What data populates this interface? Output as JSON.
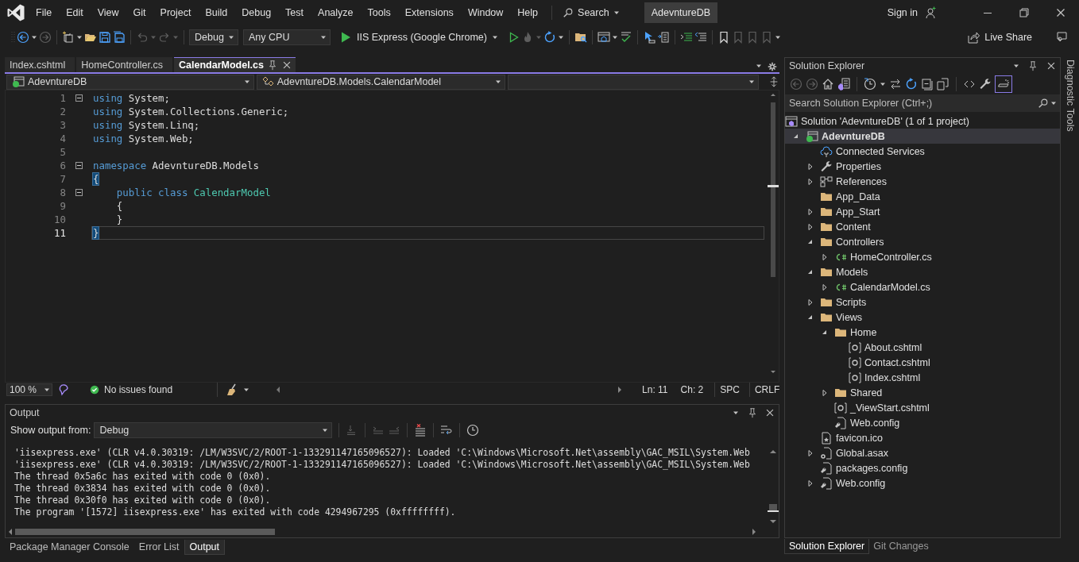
{
  "title_bar": {
    "menu": [
      "File",
      "Edit",
      "View",
      "Git",
      "Project",
      "Build",
      "Debug",
      "Test",
      "Analyze",
      "Tools",
      "Extensions",
      "Window",
      "Help"
    ],
    "search": "Search",
    "solution_name": "AdevntureDB",
    "sign_in": "Sign in"
  },
  "toolbar": {
    "configuration": "Debug",
    "platform": "Any CPU",
    "run_target": "IIS Express (Google Chrome)",
    "live_share": "Live Share"
  },
  "editor": {
    "tabs": [
      {
        "label": "Index.cshtml",
        "selected": false
      },
      {
        "label": "HomeController.cs",
        "selected": false
      },
      {
        "label": "CalendarModel.cs",
        "selected": true
      }
    ],
    "project_dropdown": "AdevntureDB",
    "type_dropdown": "AdevntureDB.Models.CalendarModel",
    "lines": [
      {
        "number": "1",
        "fold": true,
        "current": false,
        "tokens": [
          {
            "text": "using",
            "kind": "keyword"
          },
          {
            "text": " System;",
            "kind": "plain"
          }
        ]
      },
      {
        "number": "2",
        "fold": false,
        "current": false,
        "tokens": [
          {
            "text": "using",
            "kind": "keyword"
          },
          {
            "text": " System.Collections.Generic;",
            "kind": "plain"
          }
        ]
      },
      {
        "number": "3",
        "fold": false,
        "current": false,
        "tokens": [
          {
            "text": "using",
            "kind": "keyword"
          },
          {
            "text": " System.Linq;",
            "kind": "plain"
          }
        ]
      },
      {
        "number": "4",
        "fold": false,
        "current": false,
        "tokens": [
          {
            "text": "using",
            "kind": "keyword"
          },
          {
            "text": " System.Web;",
            "kind": "plain"
          }
        ]
      },
      {
        "number": "5",
        "fold": false,
        "current": false
      },
      {
        "number": "6",
        "fold": true,
        "current": false,
        "tokens": [
          {
            "text": "namespace",
            "kind": "keyword"
          },
          {
            "text": " AdevntureDB.Models",
            "kind": "plain"
          }
        ]
      },
      {
        "number": "7",
        "fold": false,
        "current": false,
        "tokens": [
          {
            "text": "{",
            "kind": "brace-match"
          }
        ]
      },
      {
        "number": "8",
        "fold": true,
        "current": false,
        "tokens": [
          {
            "text": "    public class",
            "kind": "keyword"
          },
          {
            "text": " CalendarModel",
            "kind": "type"
          }
        ]
      },
      {
        "number": "9",
        "fold": false,
        "current": false,
        "tokens": [
          {
            "text": "    {",
            "kind": "plain"
          }
        ]
      },
      {
        "number": "10",
        "fold": false,
        "current": false,
        "tokens": [
          {
            "text": "    }",
            "kind": "plain"
          }
        ]
      },
      {
        "number": "11",
        "fold": false,
        "current": true,
        "tokens": [
          {
            "text": "}",
            "kind": "brace-match"
          }
        ]
      }
    ],
    "status": {
      "zoom": "100 %",
      "issues": "No issues found",
      "line": "Ln: 11",
      "column": "Ch: 2",
      "whitespace": "SPC",
      "line_ending": "CRLF"
    }
  },
  "output": {
    "title": "Output",
    "source_label": "Show output from:",
    "source": "Debug",
    "lines": [
      "'iisexpress.exe' (CLR v4.0.30319: /LM/W3SVC/2/ROOT-1-133291147165096527): Loaded 'C:\\Windows\\Microsoft.Net\\assembly\\GAC_MSIL\\System.Web",
      "'iisexpress.exe' (CLR v4.0.30319: /LM/W3SVC/2/ROOT-1-133291147165096527): Loaded 'C:\\Windows\\Microsoft.Net\\assembly\\GAC_MSIL\\System.Web",
      "The thread 0x5a6c has exited with code 0 (0x0).",
      "The thread 0x3834 has exited with code 0 (0x0).",
      "The thread 0x30f0 has exited with code 0 (0x0).",
      "The program '[1572] iisexpress.exe' has exited with code 4294967295 (0xffffffff)."
    ]
  },
  "bottom_tabs": [
    {
      "label": "Package Manager Console",
      "selected": false
    },
    {
      "label": "Error List",
      "selected": false
    },
    {
      "label": "Output",
      "selected": true
    }
  ],
  "solution_explorer": {
    "title": "Solution Explorer",
    "preview_on": true,
    "search_placeholder": "Search Solution Explorer (Ctrl+;)",
    "tree": [
      {
        "label": "Solution 'AdevntureDB' (1 of 1 project)",
        "kind": "solution",
        "selected": false,
        "children": [
          {
            "label": "AdevntureDB",
            "kind": "project",
            "expanded": true,
            "selected": true,
            "children": [
              {
                "label": "Connected Services",
                "kind": "connected",
                "selected": false
              },
              {
                "label": "Properties",
                "kind": "properties",
                "expanded": false,
                "selected": false
              },
              {
                "label": "References",
                "kind": "references",
                "expanded": false,
                "selected": false
              },
              {
                "label": "App_Data",
                "kind": "folder",
                "selected": false
              },
              {
                "label": "App_Start",
                "kind": "folder",
                "expanded": false,
                "selected": false
              },
              {
                "label": "Content",
                "kind": "folder",
                "expanded": false,
                "selected": false
              },
              {
                "label": "Controllers",
                "kind": "folder",
                "expanded": true,
                "selected": false,
                "children": [
                  {
                    "label": "HomeController.cs",
                    "kind": "csharp",
                    "expanded": false,
                    "selected": false
                  }
                ]
              },
              {
                "label": "Models",
                "kind": "folder",
                "expanded": true,
                "selected": false,
                "children": [
                  {
                    "label": "CalendarModel.cs",
                    "kind": "csharp",
                    "expanded": false,
                    "selected": false
                  }
                ]
              },
              {
                "label": "Scripts",
                "kind": "folder",
                "expanded": false,
                "selected": false
              },
              {
                "label": "Views",
                "kind": "folder",
                "expanded": true,
                "selected": false,
                "children": [
                  {
                    "label": "Home",
                    "kind": "folder",
                    "expanded": true,
                    "selected": false,
                    "children": [
                      {
                        "label": "About.cshtml",
                        "kind": "razor",
                        "selected": false
                      },
                      {
                        "label": "Contact.cshtml",
                        "kind": "razor",
                        "selected": false
                      },
                      {
                        "label": "Index.cshtml",
                        "kind": "razor",
                        "selected": false
                      }
                    ]
                  },
                  {
                    "label": "Shared",
                    "kind": "folder",
                    "expanded": false,
                    "selected": false
                  },
                  {
                    "label": "_ViewStart.cshtml",
                    "kind": "razor",
                    "selected": false
                  },
                  {
                    "label": "Web.config",
                    "kind": "config",
                    "selected": false
                  }
                ]
              },
              {
                "label": "favicon.ico",
                "kind": "image",
                "selected": false
              },
              {
                "label": "Global.asax",
                "kind": "global",
                "expanded": false,
                "selected": false
              },
              {
                "label": "packages.config",
                "kind": "config",
                "selected": false
              },
              {
                "label": "Web.config",
                "kind": "config",
                "expanded": false,
                "selected": false
              }
            ]
          }
        ]
      }
    ],
    "tabs": [
      {
        "label": "Solution Explorer",
        "selected": true
      },
      {
        "label": "Git Changes",
        "selected": false
      }
    ]
  },
  "side_strip": {
    "label": "Diagnostic Tools"
  }
}
